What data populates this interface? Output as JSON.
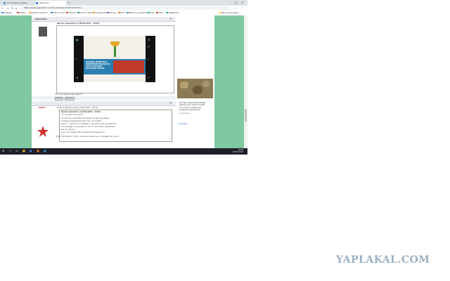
{
  "browser": {
    "tabs": [
      {
        "label": "Голосуйте за ваш...",
        "active": false,
        "color": "#4a90d9"
      },
      {
        "label": "ЯПлакал",
        "active": true,
        "color": "#1a73e8"
      }
    ],
    "url": "https://www.yaplakal.com/forum2/topic2139.html?hl=..."
  },
  "bookmarks": [
    {
      "label": "Сервисы",
      "color": "#4285f4"
    },
    {
      "label": "Яндекс",
      "color": "#e74c3c"
    },
    {
      "label": "Шаблон портала",
      "color": "#f39c12"
    },
    {
      "label": "Найти поиск",
      "color": "#3498db"
    },
    {
      "label": "Youtube",
      "color": "#e74c3c"
    },
    {
      "label": "НАТО отмена",
      "color": "#27ae60"
    },
    {
      "label": "сообщество",
      "color": "#f39c12"
    },
    {
      "label": "Авторы",
      "color": "#9b59b6"
    },
    {
      "label": "Фото",
      "color": "#e67e22"
    },
    {
      "label": "Работа в интернете",
      "color": "#3498db"
    },
    {
      "label": "Путь",
      "color": "#2ecc71"
    },
    {
      "label": "Сайт",
      "color": "#e74c3c"
    },
    {
      "label": "Обработка",
      "color": "#1abc9c"
    },
    {
      "label": "Другие закладки",
      "color": "#f1c40f"
    }
  ],
  "post1": {
    "author": "nanodrive",
    "header": "Цитата (nanodrive @ 09.06.2021 - 18:22)",
    "caption": "Что он курил или курит?",
    "buttons": [
      "Ответ",
      "Цитата"
    ]
  },
  "ad": {
    "text": "ХОЧЕШЬ ВЫИГРАТЬ СЕМЕЙНЫЙ ПОХОД НА МАТЧ РОССИИ? ПОЛУЧАЙ ПРИЗЫ"
  },
  "sidebar": {
    "lines": [
      "Смотри новые футбольные",
      "обзоры уже сейчас! Узнай",
      "кто станет чемпионом",
      "в нашем приложении"
    ],
    "link": "Подробнее",
    "link2": "Реклама"
  },
  "post2": {
    "author": "ZZpill",
    "header": "Цитата (Рыжий заяц @ 09.06.2021 - 18:30)",
    "lines": [
      "Цитата (nanodrive @ 09.06.2021 - 18:22)",
      "Что он курил или курит?",
      "Он просто не понимает как можно по-другому делать",
      "по-моему нормальные люди так и поступают",
      "смысл — для тех кто понимает о чём речь и как оно работает",
      "это уже давно так делается, так что тут нечего удивляться",
      "всё как обычно",
      "а вот этот момент мне понравился больше всего"
    ],
    "footer": "Ответ: 09.06.2021 - 18:31 · Согласен полностью, это правда так и есть"
  },
  "taskbar": {
    "time": "18:36",
    "date": "09.06.2021"
  },
  "watermark": "YAPLAKAL.COM"
}
